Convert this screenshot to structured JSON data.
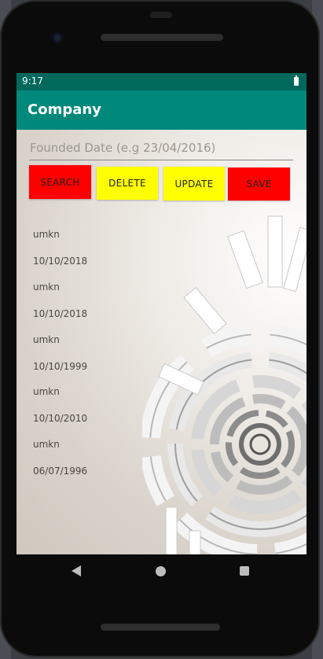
{
  "status_bar": {
    "time": "9:17"
  },
  "app_bar": {
    "title": "Company"
  },
  "form": {
    "founded_date_placeholder": "Founded Date (e.g 23/04/2016)",
    "founded_date_value": ""
  },
  "buttons": [
    {
      "label": "SEARCH",
      "color": "#ff0000"
    },
    {
      "label": "DELETE",
      "color": "#ffff00"
    },
    {
      "label": "UPDATE",
      "color": "#ffff00"
    },
    {
      "label": "SAVE",
      "color": "#ff0000"
    }
  ],
  "records": [
    "umkn",
    "10/10/2018",
    "umkn",
    "10/10/2018",
    "umkn",
    "10/10/1999",
    "umkn",
    "10/10/2010",
    "umkn",
    "06/07/1996"
  ],
  "icons": {
    "battery": "battery-icon",
    "back": "back-icon",
    "home": "home-icon",
    "recents": "recents-icon"
  },
  "colors": {
    "status_bar": "#00695c",
    "app_bar": "#00897b"
  }
}
